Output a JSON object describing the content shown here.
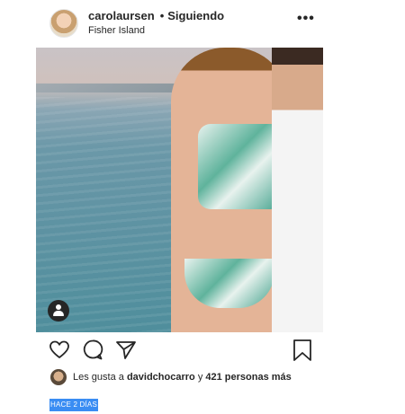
{
  "post": {
    "header": {
      "username": "carolaursen",
      "separator": "•",
      "follow_status": "Siguiendo",
      "location": "Fisher Island",
      "more_label": "•••"
    },
    "actions": {
      "like_icon": "heart-icon",
      "comment_icon": "comment-icon",
      "share_icon": "paper-plane-icon",
      "save_icon": "bookmark-icon"
    },
    "likes": {
      "prefix": "Les gusta a",
      "liker": "davidchocarro",
      "connector": "y",
      "others": "421 personas más"
    },
    "timestamp": "HACE 2 DÍAS"
  }
}
